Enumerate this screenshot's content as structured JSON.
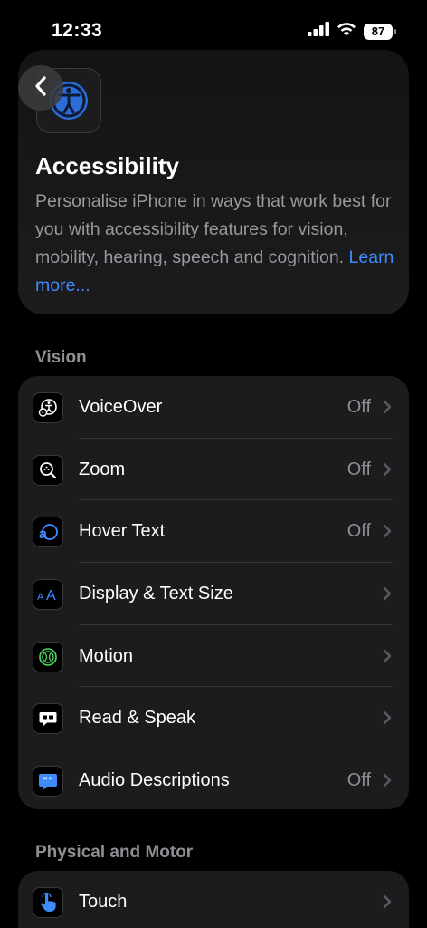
{
  "status_bar": {
    "time": "12:33",
    "battery": "87"
  },
  "header": {
    "title": "Accessibility",
    "description": "Personalise iPhone in ways that work best for you with accessibility features for vision, mobility, hearing, speech and cognition.",
    "learn_more": "Learn more..."
  },
  "sections": {
    "vision": {
      "title": "Vision",
      "items": [
        {
          "label": "VoiceOver",
          "value": "Off",
          "icon": "voiceover-icon"
        },
        {
          "label": "Zoom",
          "value": "Off",
          "icon": "zoom-icon"
        },
        {
          "label": "Hover Text",
          "value": "Off",
          "icon": "hover-text-icon"
        },
        {
          "label": "Display & Text Size",
          "value": "",
          "icon": "text-size-icon"
        },
        {
          "label": "Motion",
          "value": "",
          "icon": "motion-icon"
        },
        {
          "label": "Read & Speak",
          "value": "",
          "icon": "speech-bubble-icon"
        },
        {
          "label": "Audio Descriptions",
          "value": "Off",
          "icon": "audio-descriptions-icon"
        }
      ]
    },
    "physical": {
      "title": "Physical and Motor",
      "items": [
        {
          "label": "Touch",
          "value": "",
          "icon": "touch-hand-icon"
        }
      ]
    }
  },
  "colors": {
    "accent": "#3d8bfd",
    "background": "#000000",
    "group_background": "#1c1c1e",
    "secondary_text": "#8e8e93"
  }
}
